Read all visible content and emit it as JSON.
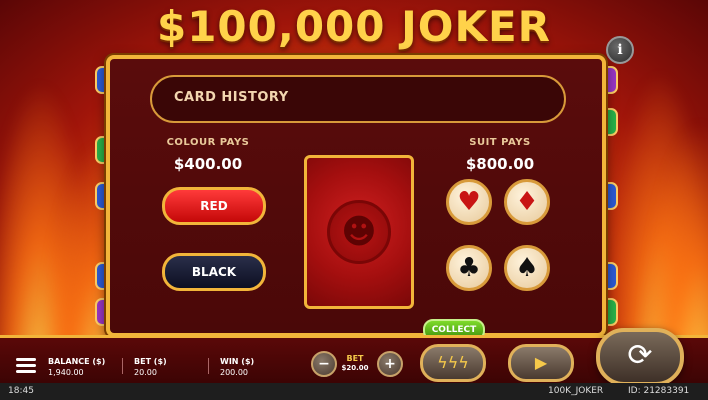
{
  "game": {
    "title": "$100,000 JOKER"
  },
  "info_button": {
    "label": "i"
  },
  "card_history": {
    "label": "CARD HISTORY"
  },
  "colour_pays": {
    "title": "COLOUR PAYS",
    "amount": "$400.00",
    "red_label": "RED",
    "black_label": "BLACK"
  },
  "suit_pays": {
    "title": "SUIT PAYS",
    "amount": "$800.00",
    "suits": [
      {
        "name": "heart",
        "symbol": "♥"
      },
      {
        "name": "diamond",
        "symbol": "♦"
      },
      {
        "name": "club",
        "symbol": "♣"
      },
      {
        "name": "spade",
        "symbol": "♠"
      }
    ]
  },
  "card": {
    "emblem": "joker-emblem-icon",
    "emblem_glyph": "☻"
  },
  "collect": {
    "label": "COLLECT"
  },
  "bottom_bar": {
    "balance_label": "BALANCE ($)",
    "balance_value": "1,940.00",
    "bet_label": "BET ($)",
    "bet_value": "20.00",
    "win_label": "WIN ($)",
    "win_value": "200.00",
    "bet_stepper_label": "BET",
    "bet_stepper_value": "$20.00",
    "minus": "−",
    "plus": "+",
    "turbo": "ϟϟϟ",
    "play": "▶",
    "spin": "⟳"
  },
  "status": {
    "time": "18:45",
    "game_code": "100K_JOKER",
    "id": "ID: 21283391"
  },
  "colors": {
    "gold": "#f2b53a",
    "panel": "#4a0808",
    "red_button": "#c40808",
    "black_button": "#0c0f22",
    "collect_green": "#3f8f0c"
  }
}
